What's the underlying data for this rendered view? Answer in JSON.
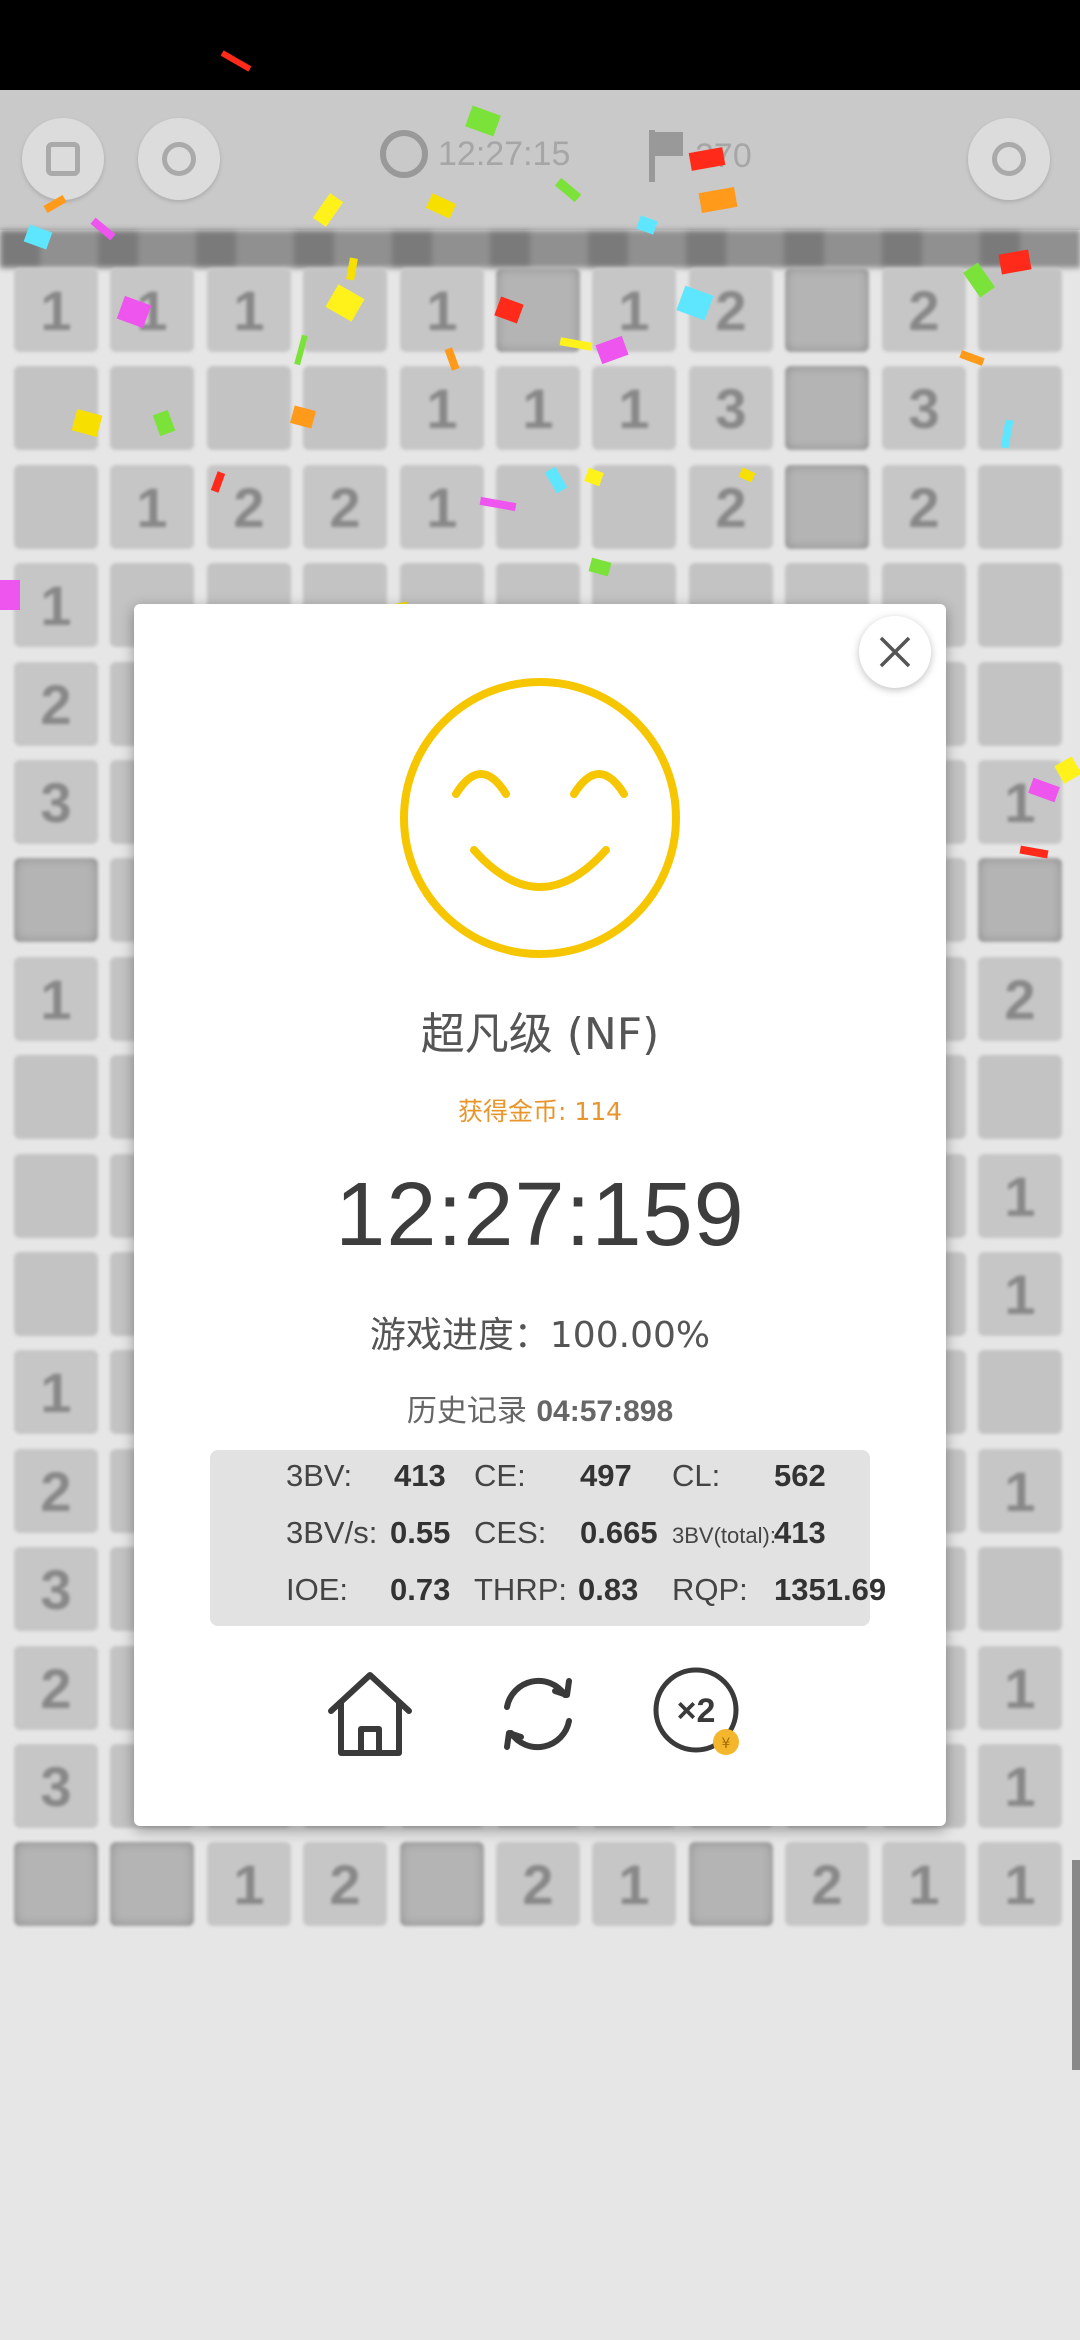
{
  "toolbar": {
    "timer_text": "12:27:15",
    "flag_count_text": "270"
  },
  "board": {
    "rows": [
      [
        "1",
        "1",
        "1",
        "",
        "1",
        "#",
        "1",
        "2",
        "#",
        "2",
        ""
      ],
      [
        "",
        "",
        "",
        "",
        "1",
        "1",
        "1",
        "3",
        "#",
        "3",
        ""
      ],
      [
        "",
        "1",
        "2",
        "2",
        "1",
        "",
        "",
        "2",
        "#",
        "2",
        ""
      ],
      [
        "1",
        "",
        "",
        "",
        "",
        "",
        "",
        "",
        "",
        "",
        ""
      ],
      [
        "2",
        "",
        "",
        "",
        "",
        "",
        "",
        "",
        "",
        "",
        ""
      ],
      [
        "3",
        "",
        "",
        "",
        "",
        "",
        "",
        "",
        "",
        "",
        "1"
      ],
      [
        "#",
        "",
        "",
        "",
        "",
        "",
        "",
        "",
        "",
        "",
        "#"
      ],
      [
        "1",
        "",
        "",
        "",
        "",
        "",
        "",
        "",
        "",
        "",
        "2"
      ],
      [
        "",
        "",
        "",
        "",
        "",
        "",
        "",
        "",
        "",
        "",
        ""
      ],
      [
        "",
        "",
        "",
        "",
        "",
        "",
        "",
        "",
        "",
        "",
        "1"
      ],
      [
        "",
        "",
        "",
        "",
        "",
        "",
        "",
        "",
        "",
        "",
        "1"
      ],
      [
        "1",
        "",
        "",
        "",
        "",
        "",
        "",
        "",
        "",
        "",
        ""
      ],
      [
        "2",
        "",
        "",
        "",
        "",
        "",
        "",
        "",
        "",
        "",
        "1"
      ],
      [
        "3",
        "",
        "",
        "",
        "",
        "",
        "",
        "",
        "",
        "",
        ""
      ],
      [
        "2",
        "",
        "",
        "",
        "",
        "",
        "",
        "",
        "",
        "",
        "1"
      ],
      [
        "3",
        "",
        "",
        "",
        "",
        "",
        "",
        "",
        "",
        "",
        "1"
      ],
      [
        "#",
        "#",
        "1",
        "2",
        "#",
        "2",
        "1",
        "#",
        "2",
        "1",
        "1"
      ]
    ]
  },
  "result": {
    "rank_title": "超凡级 (NF)",
    "coins_text": "获得金币: 114",
    "time_text": "12:27:159",
    "progress_text": "游戏进度：100.00%",
    "record_label": "历史记录",
    "record_value": "04:57:898"
  },
  "stats": {
    "bv3_label": "3BV:",
    "bv3_value": "413",
    "ce_label": "CE:",
    "ce_value": "497",
    "cl_label": "CL:",
    "cl_value": "562",
    "bvs_label": "3BV/s:",
    "bvs_value": "0.55",
    "ces_label": "CES:",
    "ces_value": "0.665",
    "bvtotal_label": "3BV(total):",
    "bvtotal_value": "413",
    "ioe_label": "IOE:",
    "ioe_value": "0.73",
    "thrp_label": "THRP:",
    "thrp_value": "0.83",
    "rqp_label": "RQP:",
    "rqp_value": "1351.69"
  },
  "actions": {
    "double_badge_text": "×2"
  },
  "colors": {
    "smiley_yellow": "#f6c700",
    "coins_orange": "#e8952c",
    "icon_dark": "#3a3a3a"
  }
}
